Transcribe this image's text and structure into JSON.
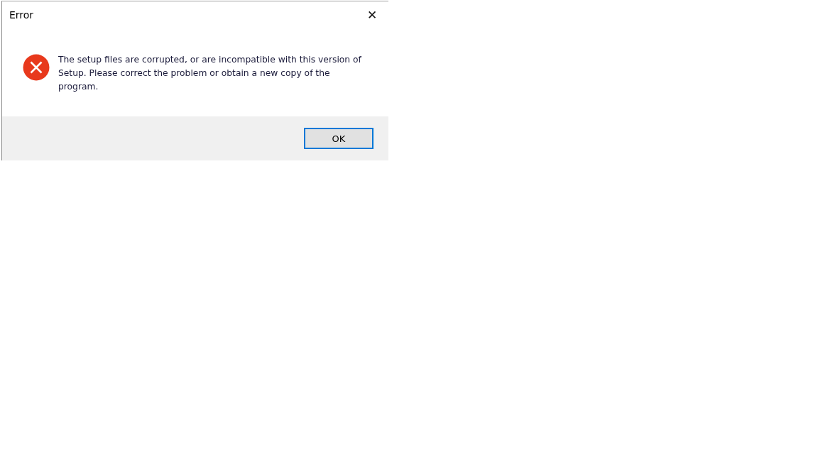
{
  "window": {
    "title": "Error",
    "close": "✕"
  },
  "message": {
    "kind": "error",
    "text": "The setup files are corrupted, or are incompatible with this version of Setup. Please correct the problem or obtain a new copy of the program."
  },
  "buttons": [
    {
      "label": "OK",
      "default": true
    }
  ]
}
